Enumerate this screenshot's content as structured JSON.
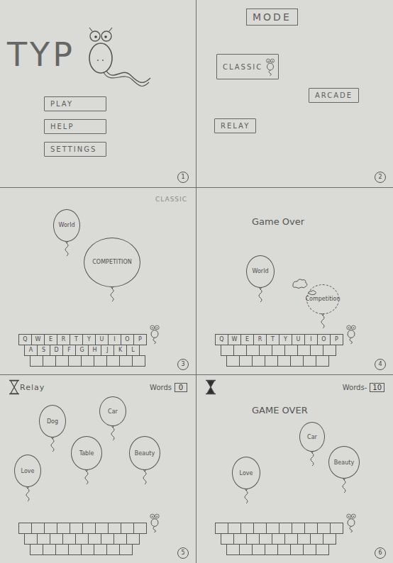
{
  "panels": [
    {
      "kind": "title",
      "number": "1",
      "logo": "TYP",
      "buttons": [
        "PLAY",
        "HELP",
        "SETTINGS"
      ]
    },
    {
      "kind": "mode",
      "number": "2",
      "heading": "MODE",
      "buttons": [
        {
          "label": "CLASSIC",
          "selected": true
        },
        {
          "label": "ARCADE",
          "selected": false
        },
        {
          "label": "RELAY",
          "selected": false
        }
      ]
    },
    {
      "kind": "game",
      "number": "3",
      "mode": "CLASSIC",
      "balloons": [
        {
          "word": "World",
          "popped": false
        },
        {
          "word": "COMPETITION",
          "popped": false
        }
      ],
      "keyboard": [
        [
          "Q",
          "W",
          "E",
          "R",
          "T",
          "Y",
          "U",
          "I",
          "O",
          "P"
        ],
        [
          "A",
          "S",
          "D",
          "F",
          "G",
          "H",
          "J",
          "K",
          "L"
        ],
        [
          "",
          "",
          "",
          "",
          "",
          "",
          "",
          "",
          ""
        ]
      ]
    },
    {
      "kind": "game",
      "number": "4",
      "message": "Game Over",
      "balloons": [
        {
          "word": "World",
          "popped": false
        },
        {
          "word": "Competition",
          "popped": true
        }
      ],
      "keyboard": [
        [
          "Q",
          "W",
          "E",
          "R",
          "T",
          "Y",
          "U",
          "I",
          "O",
          "P"
        ],
        [
          "",
          "",
          "",
          "",
          "",
          "",
          "",
          "",
          ""
        ],
        [
          "",
          "",
          "",
          "",
          "",
          "",
          "",
          ""
        ]
      ]
    },
    {
      "kind": "game",
      "number": "5",
      "mode": "Relay",
      "timer": {
        "filled": false
      },
      "counter": {
        "label": "Words",
        "value": "0"
      },
      "balloons": [
        {
          "word": "Dog",
          "popped": false
        },
        {
          "word": "Car",
          "popped": false
        },
        {
          "word": "Table",
          "popped": false
        },
        {
          "word": "Beauty",
          "popped": false
        },
        {
          "word": "Love",
          "popped": false
        }
      ],
      "keyboard": [
        [
          "",
          "",
          "",
          "",
          "",
          "",
          "",
          "",
          "",
          ""
        ],
        [
          "",
          "",
          "",
          "",
          "",
          "",
          "",
          "",
          ""
        ],
        [
          "",
          "",
          "",
          "",
          "",
          "",
          "",
          ""
        ]
      ]
    },
    {
      "kind": "game",
      "number": "6",
      "message": "GAME OVER",
      "timer": {
        "filled": true
      },
      "counter": {
        "label": "Words-",
        "value": "10"
      },
      "balloons": [
        {
          "word": "Love",
          "popped": false
        },
        {
          "word": "Car",
          "popped": false
        },
        {
          "word": "Beauty",
          "popped": false
        }
      ],
      "keyboard": [
        [
          "",
          "",
          "",
          "",
          "",
          "",
          "",
          "",
          "",
          ""
        ],
        [
          "",
          "",
          "",
          "",
          "",
          "",
          "",
          "",
          ""
        ],
        [
          "",
          "",
          "",
          "",
          "",
          "",
          "",
          ""
        ]
      ]
    }
  ]
}
